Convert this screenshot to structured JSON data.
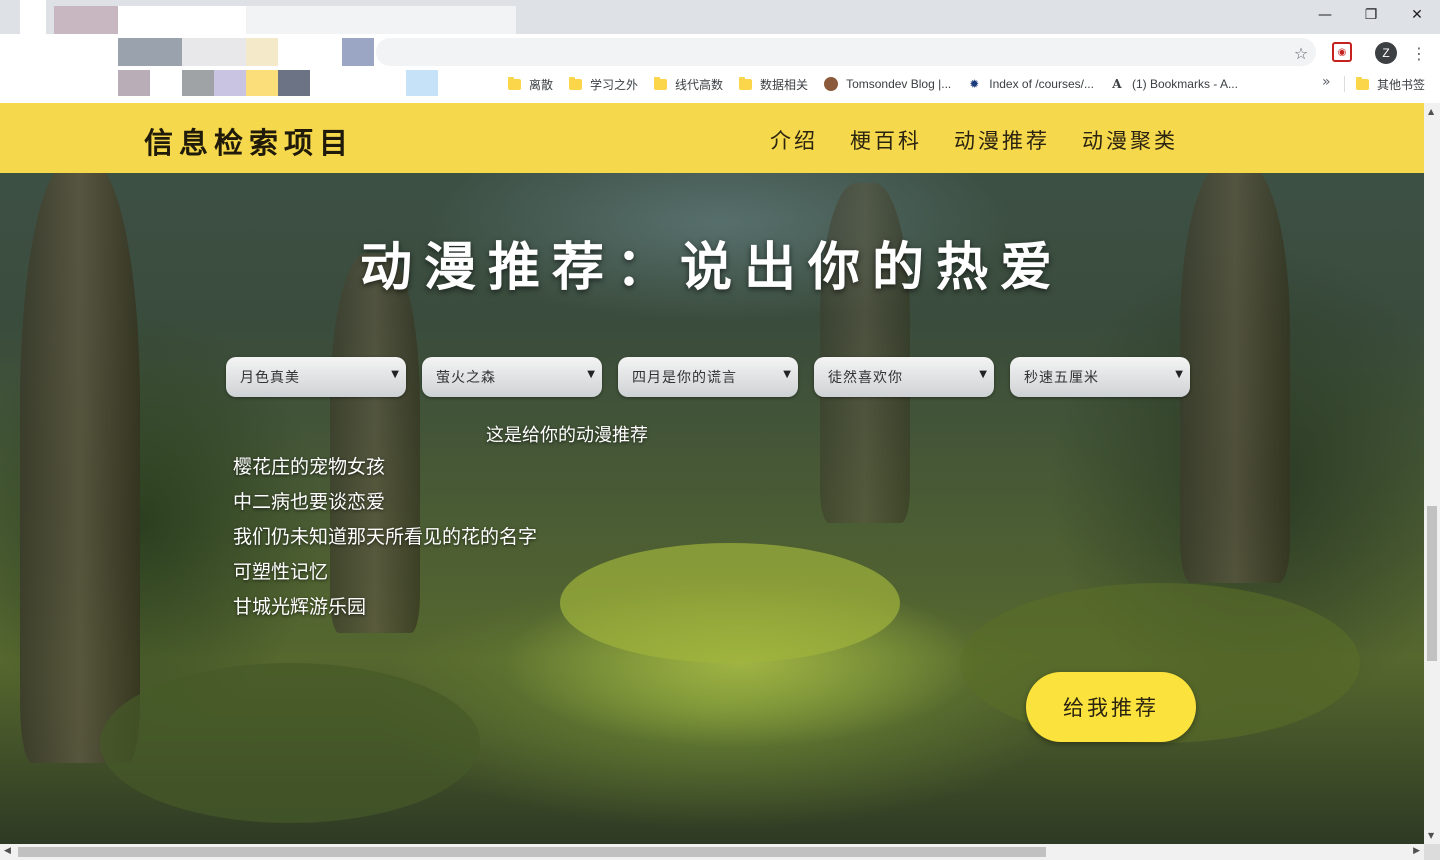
{
  "window": {
    "minimize_icon": "minimize-icon",
    "restore_icon": "restore-icon",
    "close_icon": "close-icon"
  },
  "toolbar": {
    "bookmark_star_icon": "star-icon",
    "extension_icon": "pocket-icon",
    "profile_initial": "Z",
    "menu_icon": "kebab-menu-icon"
  },
  "bookmarks": {
    "items": [
      {
        "label": "离散",
        "icon": "folder-icon"
      },
      {
        "label": "学习之外",
        "icon": "folder-icon"
      },
      {
        "label": "线代高数",
        "icon": "folder-icon"
      },
      {
        "label": "数据相关",
        "icon": "folder-icon"
      },
      {
        "label": "Tomsondev Blog |...",
        "icon": "avatar-favicon"
      },
      {
        "label": "Index of /courses/...",
        "icon": "gear-favicon"
      },
      {
        "label": "(1) Bookmarks - A...",
        "icon": "letter-a-favicon"
      }
    ],
    "more_label": "»",
    "other_label": "其他书签"
  },
  "page": {
    "brand": "信息检索项目",
    "nav": [
      {
        "label": "介绍"
      },
      {
        "label": "梗百科"
      },
      {
        "label": "动漫推荐"
      },
      {
        "label": "动漫聚类"
      }
    ],
    "hero_title": "动漫推荐：说出你的热爱",
    "selects": [
      {
        "value": "月色真美"
      },
      {
        "value": "萤火之森"
      },
      {
        "value": "四月是你的谎言"
      },
      {
        "value": "徒然喜欢你"
      },
      {
        "value": "秒速五厘米"
      }
    ],
    "result_title": "这是给你的动漫推荐",
    "results": [
      "樱花庄的宠物女孩",
      "中二病也要谈恋爱",
      "我们仍未知道那天所看见的花的名字",
      "可塑性记忆",
      "甘城光辉游乐园"
    ],
    "recommend_button": "给我推荐"
  },
  "colors": {
    "navbar": "#f6d84c",
    "button": "#fbe23c"
  }
}
